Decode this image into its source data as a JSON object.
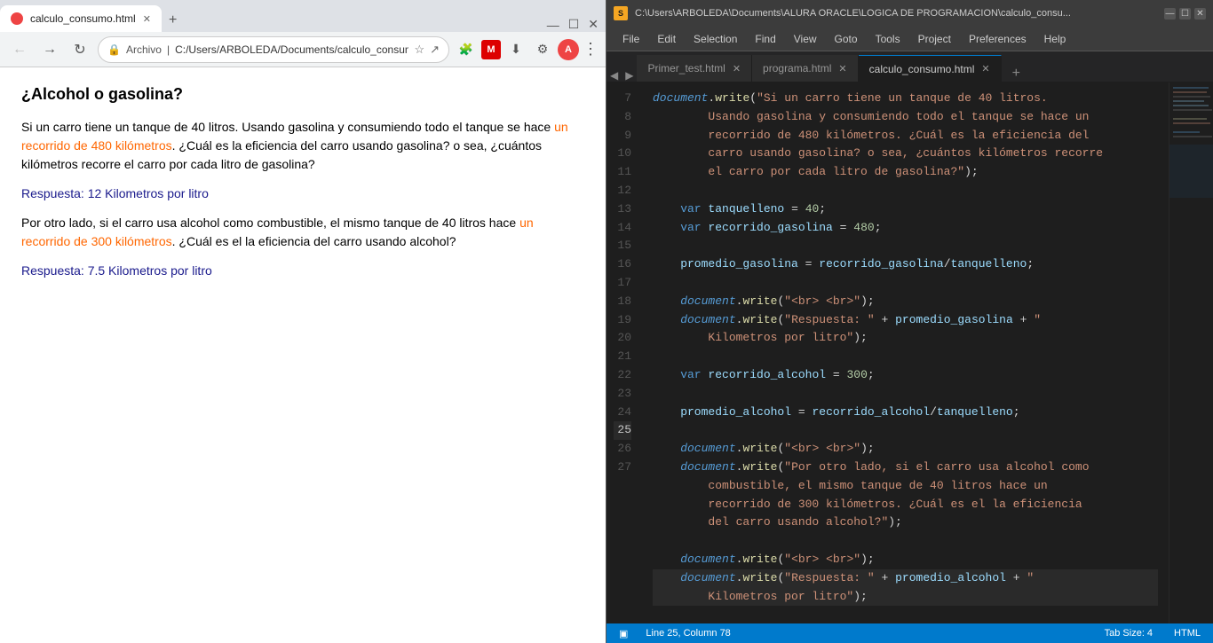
{
  "browser": {
    "tab_title": "calculo_consumo.html",
    "tab_favicon": "●",
    "address": "C:/Users/ARBOLEDA/Documen...",
    "address_full": "C:/Users/ARBOLEDA/Documents/calculo_consumo.html",
    "content": {
      "heading": "¿Alcohol o gasolina?",
      "p1": "Si un carro tiene un tanque de 40 litros. Usando gasolina y consumiendo todo el tanque se hace un recorrido de 480 kilómetros. ¿Cuál es la eficiencia del carro usando gasolina? o sea, ¿cuántos kilómetros recorre el carro por cada litro de gasolina?",
      "answer1": "Respuesta: 12 Kilometros por litro",
      "p2": "Por otro lado, si el carro usa alcohol como combustible, el mismo tanque de 40 litros hace un recorrido de 300 kilómetros. ¿Cuál es el la eficiencia del carro usando alcohol?",
      "answer2": "Respuesta: 7.5 Kilometros por litro"
    }
  },
  "editor": {
    "titlebar": {
      "path": "C:\\Users\\ARBOLEDA\\Documents\\ALURA ORACLE\\LOGICA DE PROGRAMACION\\calculo_consu...",
      "icon_color": "#f5a623"
    },
    "menu": {
      "items": [
        "File",
        "Edit",
        "Selection",
        "Find",
        "View",
        "Goto",
        "Tools",
        "Project",
        "Preferences",
        "Help"
      ]
    },
    "tabs": [
      {
        "label": "Primer_test.html",
        "active": false
      },
      {
        "label": "programa.html",
        "active": false
      },
      {
        "label": "calculo_consumo.html",
        "active": true
      }
    ],
    "statusbar": {
      "line_col": "Line 25, Column 78",
      "tab_size": "Tab Size: 4",
      "language": "HTML"
    },
    "lines": [
      7,
      8,
      9,
      10,
      11,
      12,
      13,
      14,
      15,
      16,
      17,
      18,
      19,
      20,
      21,
      22,
      23,
      24,
      25,
      26,
      27
    ],
    "active_line": 25
  }
}
